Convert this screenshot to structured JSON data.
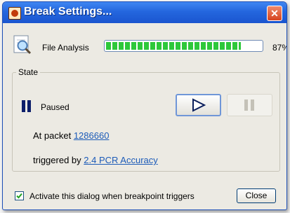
{
  "window": {
    "title": "Break Settings...",
    "close_glyph": "✕"
  },
  "analysis": {
    "label": "File Analysis",
    "progress": 0.87,
    "percent_text": "87%",
    "bar_color": "#2dc83a"
  },
  "state": {
    "legend": "State",
    "status": "Paused",
    "packet_prefix": "At packet ",
    "packet_link": "1286660",
    "trigger_prefix": "triggered by ",
    "trigger_link": "2.4 PCR Accuracy"
  },
  "footer": {
    "activate_label": "Activate this dialog when breakpoint triggers",
    "activate_checked": true,
    "close_label": "Close"
  },
  "icons": {
    "app": "app-icon",
    "analysis": "magnifier-document-icon",
    "paused": "pause-icon",
    "play": "play-icon",
    "pause_button": "pause-icon"
  },
  "colors": {
    "titlebar": "#2466de",
    "link": "#1c5bb8",
    "progress": "#2dc83a"
  }
}
